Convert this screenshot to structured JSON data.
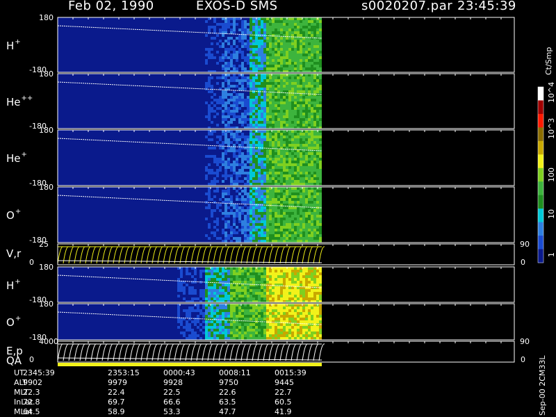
{
  "header": {
    "date": "Feb 02, 1990",
    "instrument": "EXOS-D SMS",
    "file": "s0020207.par",
    "time": "23:45:39"
  },
  "colorbar": {
    "unit": "Ct/Smp",
    "labels": [
      "10^4",
      "10^3",
      "100",
      "10",
      "1"
    ]
  },
  "panels": [
    {
      "label_base": "H",
      "label_sup": "+",
      "y_top": "180",
      "y_bottom": "-180"
    },
    {
      "label_base": "He",
      "label_sup": "++",
      "y_top": "180",
      "y_bottom": "-180"
    },
    {
      "label_base": "He",
      "label_sup": "+",
      "y_top": "180",
      "y_bottom": "-180"
    },
    {
      "label_base": "O",
      "label_sup": "+",
      "y_top": "180",
      "y_bottom": "-180"
    },
    {
      "label_base": "V,r",
      "label_sup": "",
      "y_top": "25",
      "y_bottom": "0",
      "right_top": "90",
      "right_bottom": "0"
    },
    {
      "label_base": "H",
      "label_sup": "+",
      "y_top": "180",
      "y_bottom": "-180"
    },
    {
      "label_base": "O",
      "label_sup": "+",
      "y_top": "180",
      "y_bottom": "-180"
    },
    {
      "label_base": "E,p",
      "label_sup": "",
      "y_top": "4000",
      "y_bottom": "0",
      "right_top": "90",
      "right_bottom": "0"
    }
  ],
  "qa_label": "QA",
  "side_note": "Sep-00 2CM33L",
  "footer": {
    "rows": [
      {
        "name": "UT",
        "values": [
          "2345:39",
          "2353:15",
          "0000:43",
          "0008:11",
          "0015:39"
        ]
      },
      {
        "name": "ALT",
        "values": [
          "9902",
          "9979",
          "9928",
          "9750",
          "9445"
        ]
      },
      {
        "name": "MLT",
        "values": [
          "22.3",
          "22.4",
          "22.5",
          "22.6",
          "22.7"
        ]
      },
      {
        "name": "InLat",
        "values": [
          "72.8",
          "69.7",
          "66.6",
          "63.5",
          "60.5"
        ]
      },
      {
        "name": "MLat",
        "values": [
          "64.5",
          "58.9",
          "53.3",
          "47.7",
          "41.9"
        ]
      }
    ]
  },
  "chart_data": {
    "type": "heatmap",
    "title": "Feb 02, 1990   EXOS-D SMS",
    "x_tick_labels": [
      "2345:39",
      "2353:15",
      "0000:43",
      "0008:11",
      "0015:39"
    ],
    "data_coverage_fraction": 0.5,
    "colorscale": [
      "#0a1a8c",
      "#1a4bd0",
      "#2e7fe0",
      "#00c8d8",
      "#1f8f1f",
      "#3db43d",
      "#7fd020",
      "#f2f21a",
      "#c8a800",
      "#8c6e00",
      "#ff1a00",
      "#a00000",
      "#ffffff"
    ],
    "colorscale_range": [
      1,
      10000
    ],
    "colorscale_log": true
  }
}
